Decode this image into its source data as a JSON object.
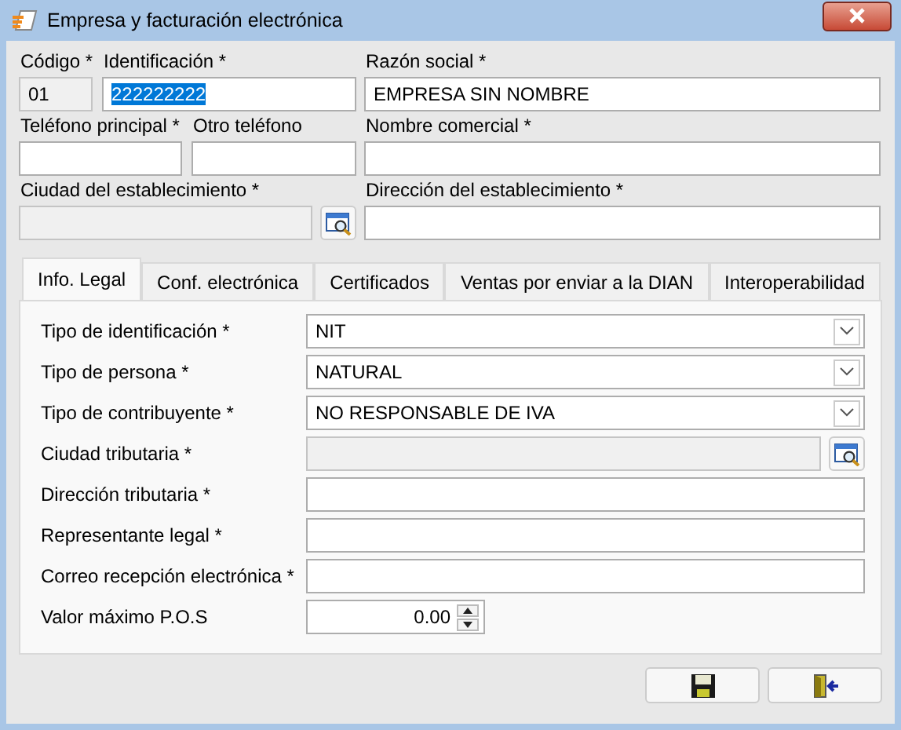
{
  "window": {
    "title": "Empresa y facturación electrónica"
  },
  "header_rows": [
    {
      "left": [
        {
          "label": "Código *",
          "value": "01",
          "kind": "text",
          "disabled": true
        },
        {
          "label": "Identificación *",
          "value": "222222222",
          "kind": "text",
          "disabled": false,
          "text_selected": true
        }
      ],
      "right": {
        "label": "Razón social *",
        "value": "EMPRESA SIN NOMBRE",
        "kind": "text",
        "disabled": false
      }
    },
    {
      "left": [
        {
          "label": "Teléfono principal *",
          "kind": "text",
          "disabled": false
        },
        {
          "label": "Otro teléfono",
          "kind": "text",
          "disabled": false
        }
      ],
      "right": {
        "label": "Nombre comercial *",
        "kind": "text",
        "disabled": false
      }
    },
    {
      "left": [
        {
          "label": "Ciudad del establecimiento *",
          "kind": "lookup",
          "disabled": true
        }
      ],
      "right": {
        "label": "Dirección del establecimiento *",
        "kind": "text",
        "disabled": false
      }
    }
  ],
  "tabs": [
    {
      "label": "Info. Legal",
      "selected": true
    },
    {
      "label": "Conf. electrónica",
      "selected": false
    },
    {
      "label": "Certificados",
      "selected": false
    },
    {
      "label": "Ventas por enviar a la DIAN",
      "selected": false
    },
    {
      "label": "Interoperabilidad",
      "selected": false
    }
  ],
  "legal_fields": [
    {
      "label": "Tipo de identificación *",
      "kind": "combo",
      "value": "NIT",
      "disabled": false
    },
    {
      "label": "Tipo de persona *",
      "kind": "combo",
      "value": "NATURAL",
      "disabled": false
    },
    {
      "label": "Tipo de contribuyente *",
      "kind": "combo",
      "value": "NO RESPONSABLE DE IVA",
      "disabled": false
    },
    {
      "label": "Ciudad tributaria *",
      "kind": "lookup",
      "disabled": true
    },
    {
      "label": "Dirección tributaria *",
      "kind": "text",
      "disabled": false
    },
    {
      "label": "Representante legal *",
      "kind": "text",
      "disabled": false
    },
    {
      "label": "Correo recepción electrónica *",
      "kind": "text",
      "disabled": false
    },
    {
      "label": "Valor máximo P.O.S",
      "kind": "spin",
      "value": "0.00",
      "disabled": false
    }
  ]
}
